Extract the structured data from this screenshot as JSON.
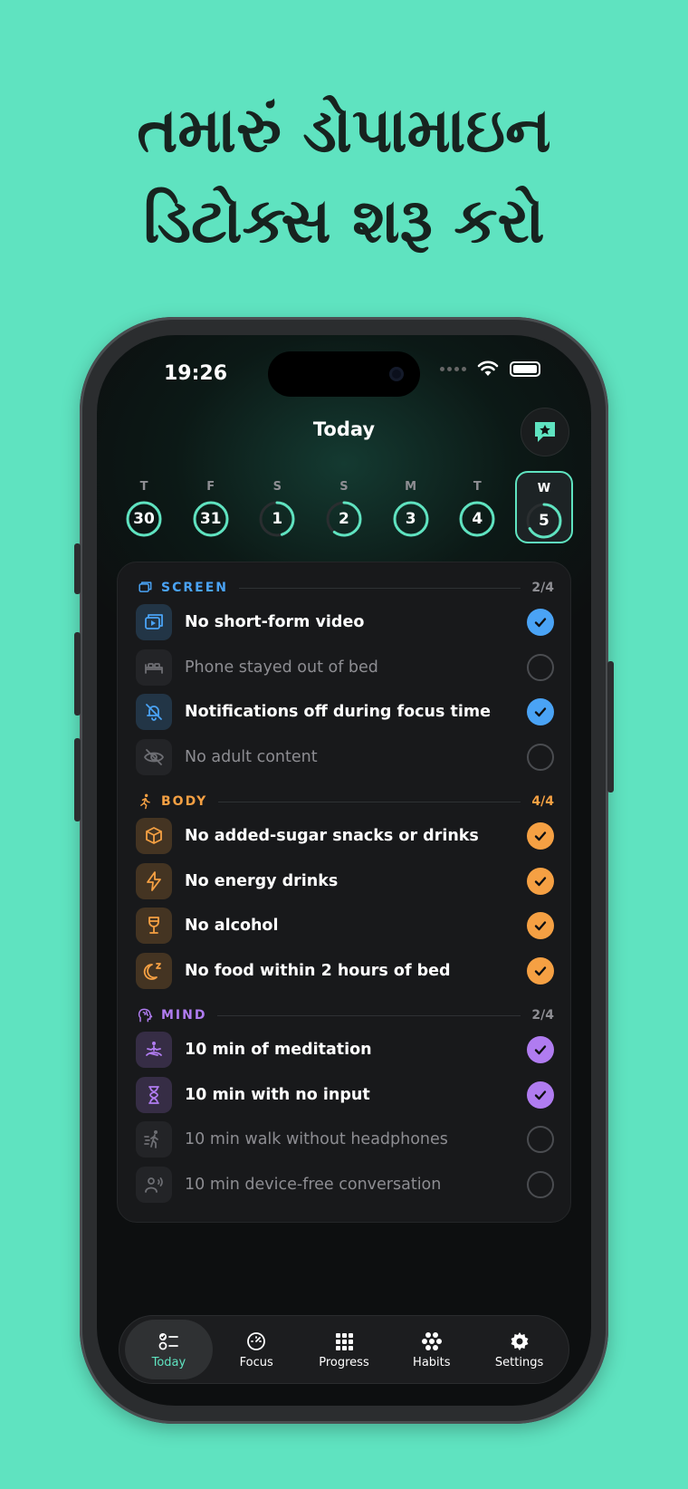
{
  "headline": [
    "તમારું ડોપામાઇન",
    "ડિટોક્સ શરૂ કરો"
  ],
  "status": {
    "time": "19:26"
  },
  "header": {
    "title": "Today",
    "chat_icon": "chat-star-icon"
  },
  "accent": "#5fe3c0",
  "week": [
    {
      "letter": "T",
      "num": "30",
      "progress": 1.0,
      "selected": false
    },
    {
      "letter": "F",
      "num": "31",
      "progress": 1.0,
      "selected": false
    },
    {
      "letter": "S",
      "num": "1",
      "progress": 0.45,
      "selected": false
    },
    {
      "letter": "S",
      "num": "2",
      "progress": 0.6,
      "selected": false
    },
    {
      "letter": "M",
      "num": "3",
      "progress": 1.0,
      "selected": false
    },
    {
      "letter": "T",
      "num": "4",
      "progress": 1.0,
      "selected": false
    },
    {
      "letter": "W",
      "num": "5",
      "progress": 0.67,
      "selected": true
    }
  ],
  "sections": [
    {
      "name": "SCREEN",
      "count": "2/4",
      "color": "#4aa3f5",
      "icon": "screens-icon",
      "items": [
        {
          "label": "No short-form video",
          "done": true,
          "icon": "video-icon"
        },
        {
          "label": "Phone stayed out of bed",
          "done": false,
          "icon": "bed-icon"
        },
        {
          "label": "Notifications off during focus time",
          "done": true,
          "icon": "bell-off-icon"
        },
        {
          "label": "No adult content",
          "done": false,
          "icon": "eye-off-icon"
        }
      ]
    },
    {
      "name": "BODY",
      "count": "4/4",
      "color": "#f5a043",
      "icon": "runner-icon",
      "items": [
        {
          "label": "No added-sugar snacks or drinks",
          "done": true,
          "icon": "cube-icon"
        },
        {
          "label": "No energy drinks",
          "done": true,
          "icon": "bolt-icon"
        },
        {
          "label": "No alcohol",
          "done": true,
          "icon": "wine-glass-icon"
        },
        {
          "label": "No food within 2 hours of bed",
          "done": true,
          "icon": "moon-sleep-icon"
        }
      ]
    },
    {
      "name": "MIND",
      "count": "2/4",
      "color": "#b07cf0",
      "icon": "brain-head-icon",
      "items": [
        {
          "label": "10 min of meditation",
          "done": true,
          "icon": "meditation-icon"
        },
        {
          "label": "10 min with no input",
          "done": true,
          "icon": "hourglass-icon"
        },
        {
          "label": "10 min walk without headphones",
          "done": false,
          "icon": "walking-icon"
        },
        {
          "label": "10 min device-free conversation",
          "done": false,
          "icon": "people-talk-icon"
        }
      ]
    }
  ],
  "tabs": [
    {
      "label": "Today",
      "icon": "checklist-icon",
      "active": true
    },
    {
      "label": "Focus",
      "icon": "gauge-icon",
      "active": false
    },
    {
      "label": "Progress",
      "icon": "grid-icon",
      "active": false
    },
    {
      "label": "Habits",
      "icon": "cluster-icon",
      "active": false
    },
    {
      "label": "Settings",
      "icon": "gear-icon",
      "active": false
    }
  ]
}
